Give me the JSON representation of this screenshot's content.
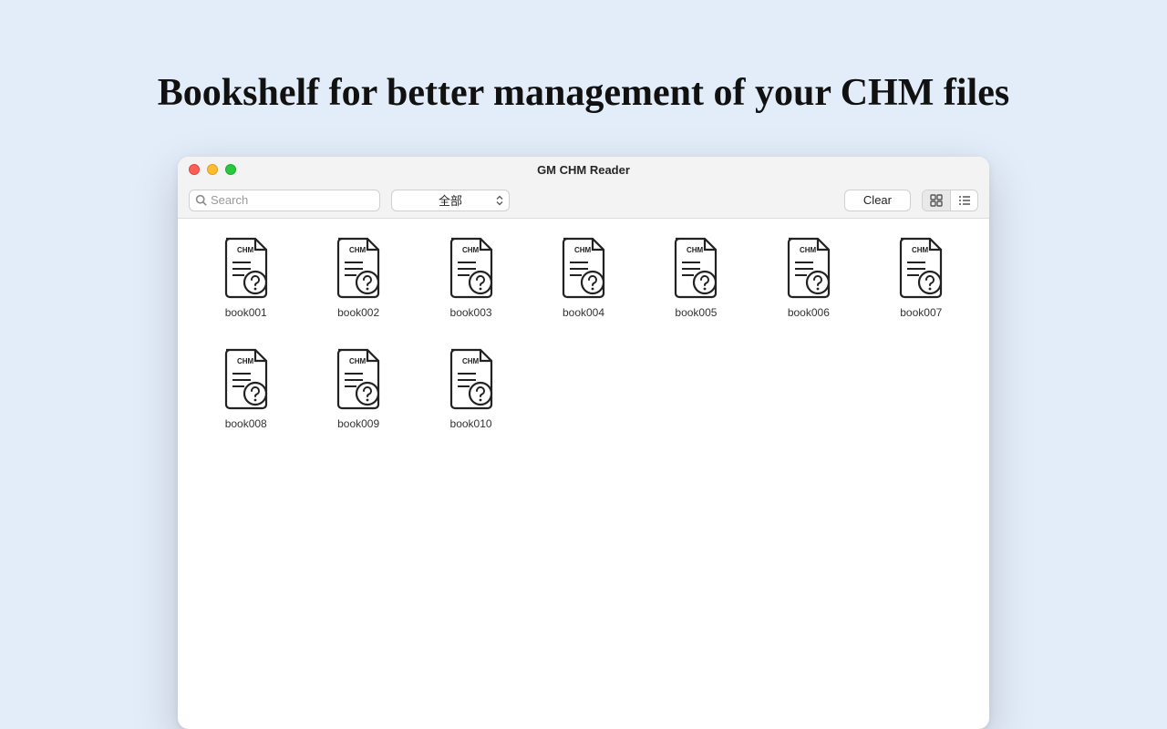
{
  "headline": "Bookshelf for better management of your CHM files",
  "window": {
    "title": "GM CHM Reader"
  },
  "toolbar": {
    "search_placeholder": "Search",
    "filter_label": "全部",
    "clear_label": "Clear"
  },
  "icon": {
    "chm_text": "CHM"
  },
  "items": [
    {
      "label": "book001"
    },
    {
      "label": "book002"
    },
    {
      "label": "book003"
    },
    {
      "label": "book004"
    },
    {
      "label": "book005"
    },
    {
      "label": "book006"
    },
    {
      "label": "book007"
    },
    {
      "label": "book008"
    },
    {
      "label": "book009"
    },
    {
      "label": "book010"
    }
  ]
}
